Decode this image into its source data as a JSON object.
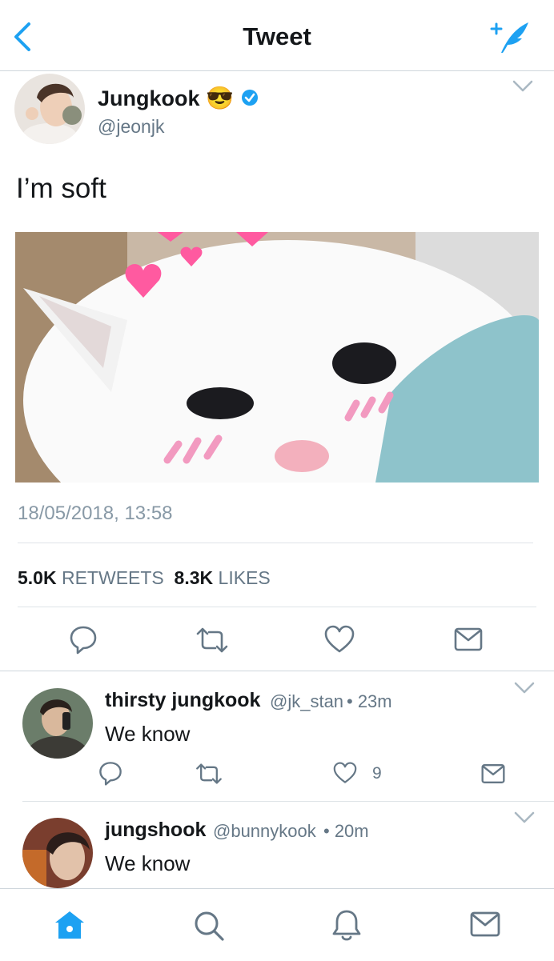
{
  "header": {
    "title": "Tweet",
    "back_icon": "back-chevron-icon",
    "compose_icon": "compose-tweet-icon"
  },
  "colors": {
    "accent": "#1da1f2",
    "icon_gray": "#657786",
    "border": "#e1e8ed",
    "text": "#14171a"
  },
  "tweet": {
    "display_name": "Jungkook",
    "emoji": "😎",
    "verified": true,
    "handle": "@jeonjk",
    "text": "I’m soft",
    "timestamp": "18/05/2018, 13:58",
    "retweets_count": "5.0K",
    "retweets_label": "RETWEETS",
    "likes_count": "8.3K",
    "likes_label": "LIKES"
  },
  "replies": [
    {
      "name": "thirsty jungkook",
      "handle": "@jk_stan",
      "time": "• 23m",
      "text": "We know",
      "likes": "9"
    },
    {
      "name": "jungshook",
      "handle": "@bunnykook",
      "time": "• 20m",
      "text": "We know"
    }
  ],
  "tabs": [
    "home-icon",
    "search-icon",
    "notifications-icon",
    "messages-icon"
  ]
}
